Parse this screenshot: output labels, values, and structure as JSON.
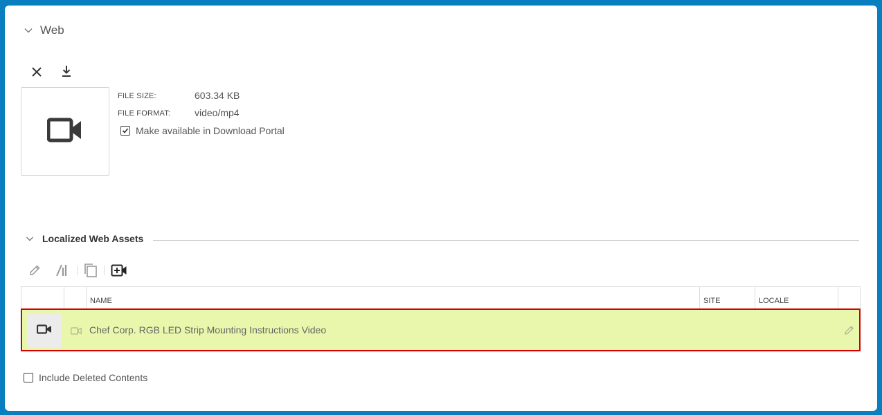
{
  "web_section": {
    "title": "Web",
    "meta": {
      "file_size_label": "FILE SIZE:",
      "file_size_value": "603.34 KB",
      "file_format_label": "FILE FORMAT:",
      "file_format_value": "video/mp4"
    },
    "download_portal": {
      "label": "Make available in Download Portal",
      "checked": true
    }
  },
  "localized_section": {
    "title": "Localized Web Assets",
    "columns": [
      "",
      "",
      "NAME",
      "SITE",
      "LOCALE",
      ""
    ],
    "rows": [
      {
        "name": "Chef Corp. RGB LED Strip Mounting Instructions Video",
        "site": "",
        "locale": "",
        "selected": true
      }
    ]
  },
  "include_deleted": {
    "label": "Include Deleted Contents",
    "checked": false
  },
  "icons": {
    "collapse": "chevron-down-icon",
    "remove": "close-icon",
    "download": "download-icon",
    "preview": "video-camera-icon",
    "edit": "pencil-icon",
    "split": "split-icon",
    "copy": "copy-icon",
    "add_video": "add-video-icon"
  },
  "colors": {
    "background": "#0a7fc0",
    "row_highlight": "#e8f7ab",
    "selection_border": "#d40000"
  }
}
